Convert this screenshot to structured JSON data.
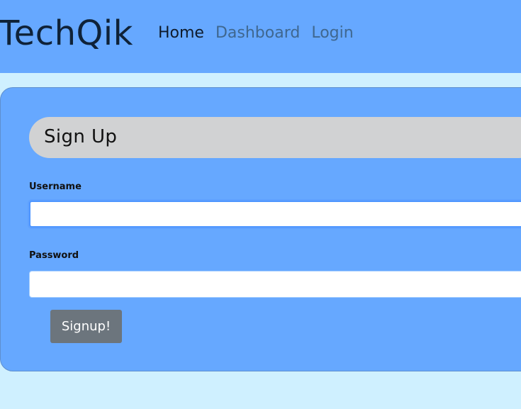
{
  "header": {
    "brand": "TechQik",
    "nav": [
      {
        "label": "Home",
        "active": true
      },
      {
        "label": "Dashboard",
        "active": false
      },
      {
        "label": "Login",
        "active": false
      }
    ]
  },
  "signup_form": {
    "title": "Sign Up",
    "username_label": "Username",
    "username_value": "",
    "username_placeholder": "",
    "password_label": "Password",
    "password_value": "",
    "password_placeholder": "",
    "submit_label": "Signup!"
  },
  "colors": {
    "page_background": "#cff0ff",
    "header_background": "#66a8ff",
    "card_background": "#66a8ff",
    "title_pill": "#d1d2d3",
    "button_background": "#6c757d"
  }
}
